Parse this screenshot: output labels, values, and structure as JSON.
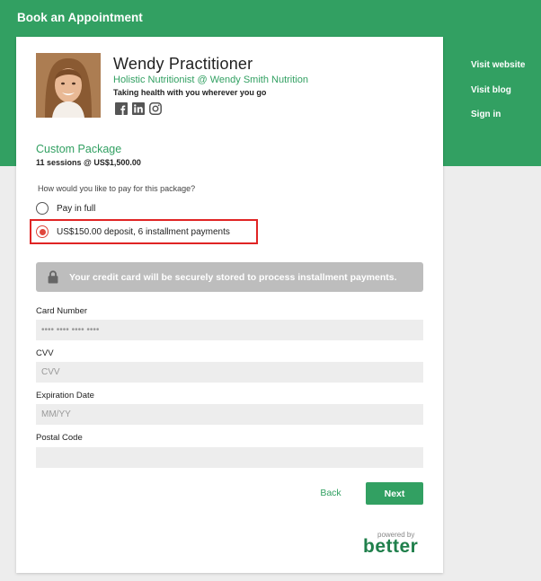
{
  "header": {
    "title": "Book an Appointment",
    "nav": [
      "Visit website",
      "Visit blog",
      "Sign in"
    ]
  },
  "profile": {
    "name": "Wendy Practitioner",
    "subtitle": "Holistic Nutritionist @ Wendy Smith Nutrition",
    "tagline": "Taking health with you wherever you go",
    "socials": [
      "facebook-icon",
      "linkedin-icon",
      "instagram-icon"
    ]
  },
  "package": {
    "title": "Custom Package",
    "summary": "11 sessions @ US$1,500.00"
  },
  "payment": {
    "question": "How would you like to pay for this package?",
    "options": [
      {
        "label": "Pay in full",
        "selected": false
      },
      {
        "label": "US$150.00 deposit, 6 installment payments",
        "selected": true
      }
    ]
  },
  "notice": "Your credit card will be securely stored to process installment payments.",
  "form": {
    "card_number": {
      "label": "Card Number",
      "placeholder": "•••• •••• •••• ••••"
    },
    "cvv": {
      "label": "CVV",
      "placeholder": "CVV"
    },
    "expiration": {
      "label": "Expiration Date",
      "placeholder": "MM/YY"
    },
    "postal": {
      "label": "Postal Code",
      "placeholder": ""
    }
  },
  "actions": {
    "back": "Back",
    "next": "Next"
  },
  "footer": {
    "powered_by": "powered by",
    "brand": "better"
  },
  "colors": {
    "brand_green": "#32a062",
    "highlight_red": "#e02424",
    "radio_red": "#e0473d"
  }
}
